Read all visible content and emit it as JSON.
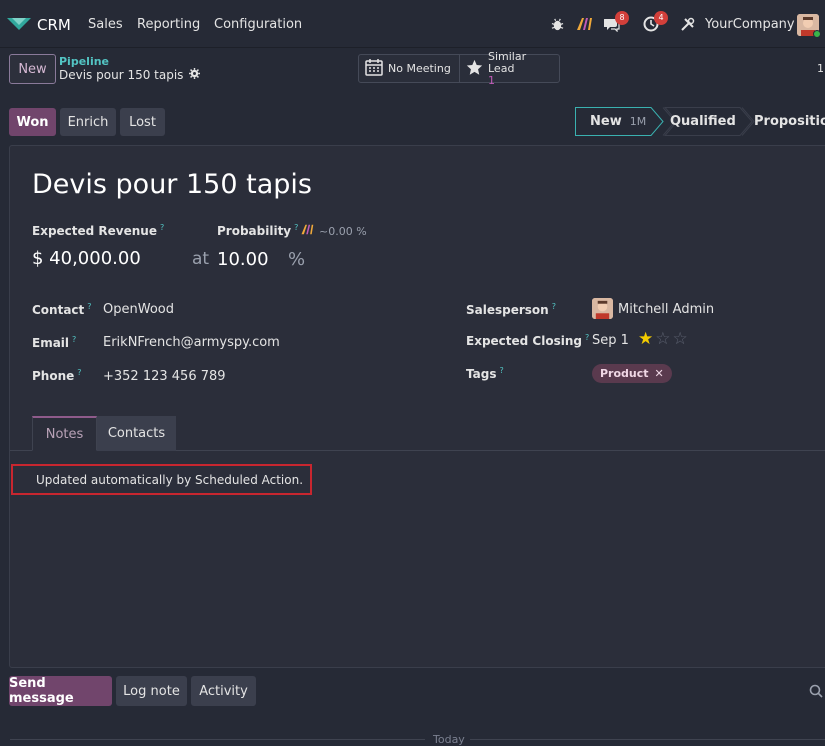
{
  "navbar": {
    "app_name": "CRM",
    "menu": [
      "Sales",
      "Reporting",
      "Configuration"
    ],
    "messages_count": "8",
    "activities_count": "4",
    "company": "YourCompany"
  },
  "control": {
    "new_label": "New",
    "breadcrumb_parent": "Pipeline",
    "breadcrumb_current": "Devis pour 150 tapis",
    "no_meeting_label": "No Meeting",
    "similar_lead_label": "Similar Lead",
    "similar_lead_count": "1",
    "pager": "1"
  },
  "status": {
    "won_label": "Won",
    "enrich_label": "Enrich",
    "lost_label": "Lost",
    "stages": [
      {
        "label": "New",
        "count": "1M"
      },
      {
        "label": "Qualified"
      },
      {
        "label": "Proposition"
      }
    ]
  },
  "lead": {
    "title": "Devis pour 150 tapis",
    "expected_revenue_label": "Expected Revenue",
    "probability_label": "Probability",
    "ai_probability": "~0.00 %",
    "revenue": "$ 40,000.00",
    "at": "at",
    "probability": "10.00",
    "percent": "%",
    "help": "?",
    "contact_label": "Contact",
    "contact": "OpenWood",
    "email_label": "Email",
    "email": "ErikNFrench@armyspy.com",
    "phone_label": "Phone",
    "phone": "+352 123 456 789",
    "salesperson_label": "Salesperson",
    "salesperson": "Mitchell Admin",
    "expected_closing_label": "Expected Closing",
    "expected_closing": "Sep 1",
    "priority_stars": 1,
    "tags_label": "Tags",
    "tag": "Product"
  },
  "notebook": {
    "tabs": [
      "Notes",
      "Contacts"
    ],
    "note": "Updated automatically by Scheduled Action."
  },
  "chatter": {
    "send_message": "Send message",
    "log_note": "Log note",
    "activity": "Activity",
    "today": "Today"
  },
  "colors": {
    "primary": "#71456c",
    "accent": "#53c4c3",
    "note_border": "#c8262f",
    "star": "#f3cc00"
  }
}
